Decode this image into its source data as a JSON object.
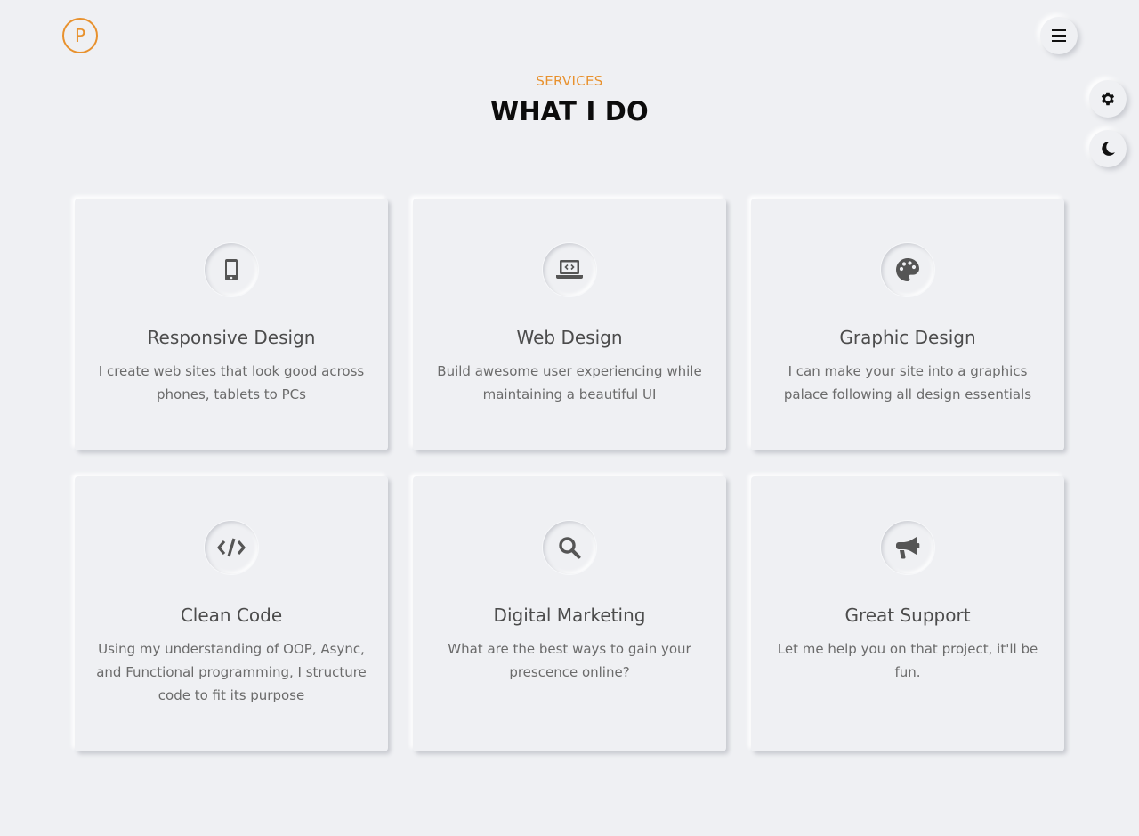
{
  "header": {
    "logo_letter": "P"
  },
  "section": {
    "eyebrow": "SERVICES",
    "title": "WHAT I DO"
  },
  "services": [
    {
      "title": "Responsive Design",
      "description": "I create web sites that look good across phones, tablets to PCs",
      "icon": "mobile-icon"
    },
    {
      "title": "Web Design",
      "description": "Build awesome user experiencing while maintaining a beautiful UI",
      "icon": "laptop-code-icon"
    },
    {
      "title": "Graphic Design",
      "description": "I can make your site into a graphics palace following all design essentials",
      "icon": "palette-icon"
    },
    {
      "title": "Clean Code",
      "description": "Using my understanding of OOP, Async, and Functional programming, I structure code to fit its purpose",
      "icon": "code-icon"
    },
    {
      "title": "Digital Marketing",
      "description": "What are the best ways to gain your prescence online?",
      "icon": "search-icon"
    },
    {
      "title": "Great Support",
      "description": "Let me help you on that project, it'll be fun.",
      "icon": "megaphone-icon"
    }
  ],
  "colors": {
    "accent": "#e8912d",
    "background": "#eff0f3",
    "icon": "#555555"
  }
}
